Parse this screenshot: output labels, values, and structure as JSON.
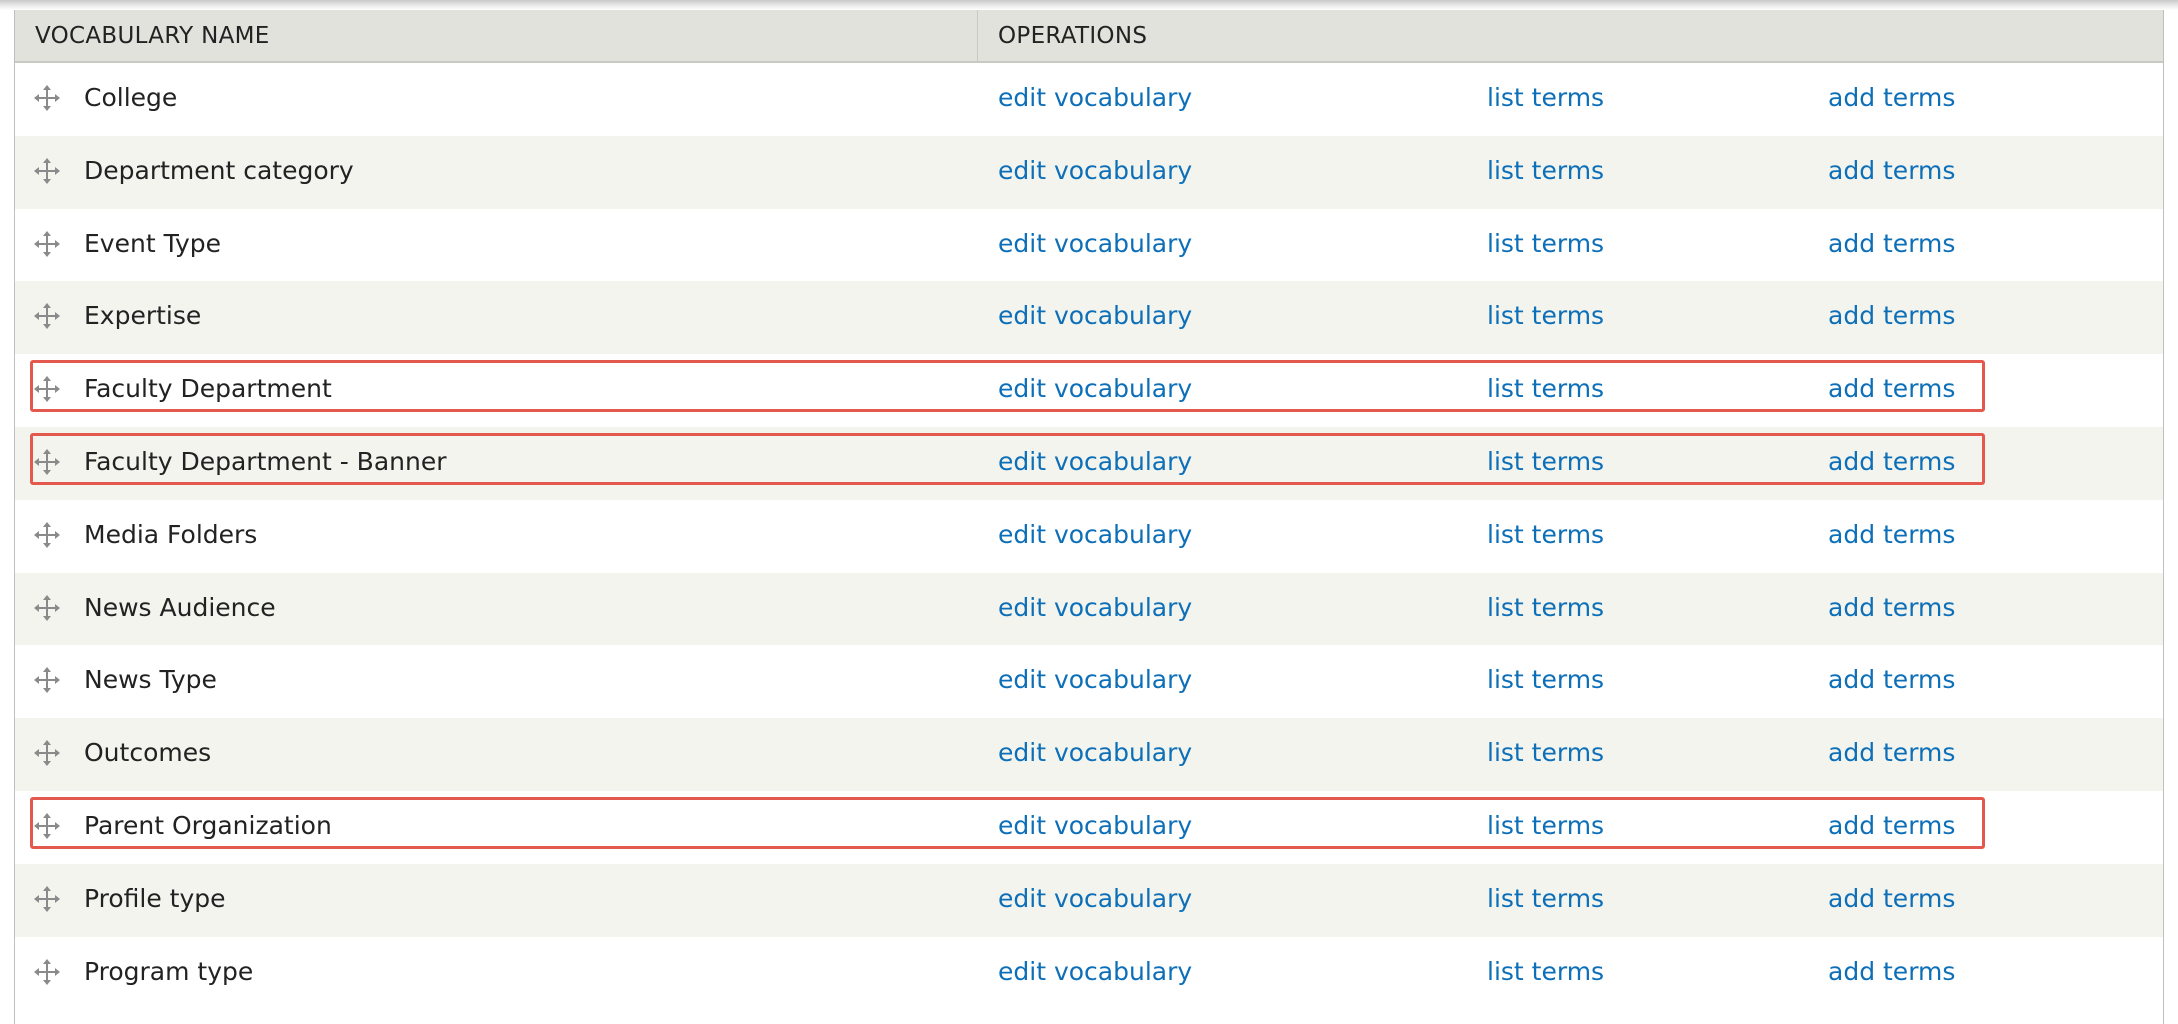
{
  "table": {
    "headers": {
      "name": "VOCABULARY NAME",
      "operations": "OPERATIONS"
    },
    "icons": {
      "drag": "drag-handle-icon"
    },
    "colors": {
      "header_bg": "#e1e2dc",
      "row_even_bg": "#f3f4ee",
      "link": "#0d6fb8",
      "highlight_border": "#e4594d"
    },
    "rows": [
      {
        "name": "College",
        "edit": "edit vocabulary",
        "list": "list terms",
        "add": "add terms",
        "highlighted": false
      },
      {
        "name": "Department category",
        "edit": "edit vocabulary",
        "list": "list terms",
        "add": "add terms",
        "highlighted": false
      },
      {
        "name": "Event Type",
        "edit": "edit vocabulary",
        "list": "list terms",
        "add": "add terms",
        "highlighted": false
      },
      {
        "name": "Expertise",
        "edit": "edit vocabulary",
        "list": "list terms",
        "add": "add terms",
        "highlighted": false
      },
      {
        "name": "Faculty Department",
        "edit": "edit vocabulary",
        "list": "list terms",
        "add": "add terms",
        "highlighted": true
      },
      {
        "name": "Faculty Department - Banner",
        "edit": "edit vocabulary",
        "list": "list terms",
        "add": "add terms",
        "highlighted": true
      },
      {
        "name": "Media Folders",
        "edit": "edit vocabulary",
        "list": "list terms",
        "add": "add terms",
        "highlighted": false
      },
      {
        "name": "News Audience",
        "edit": "edit vocabulary",
        "list": "list terms",
        "add": "add terms",
        "highlighted": false
      },
      {
        "name": "News Type",
        "edit": "edit vocabulary",
        "list": "list terms",
        "add": "add terms",
        "highlighted": false
      },
      {
        "name": "Outcomes",
        "edit": "edit vocabulary",
        "list": "list terms",
        "add": "add terms",
        "highlighted": false
      },
      {
        "name": "Parent Organization",
        "edit": "edit vocabulary",
        "list": "list terms",
        "add": "add terms",
        "highlighted": true
      },
      {
        "name": "Profile type",
        "edit": "edit vocabulary",
        "list": "list terms",
        "add": "add terms",
        "highlighted": false
      },
      {
        "name": "Program type",
        "edit": "edit vocabulary",
        "list": "list terms",
        "add": "add terms",
        "highlighted": false
      }
    ]
  }
}
